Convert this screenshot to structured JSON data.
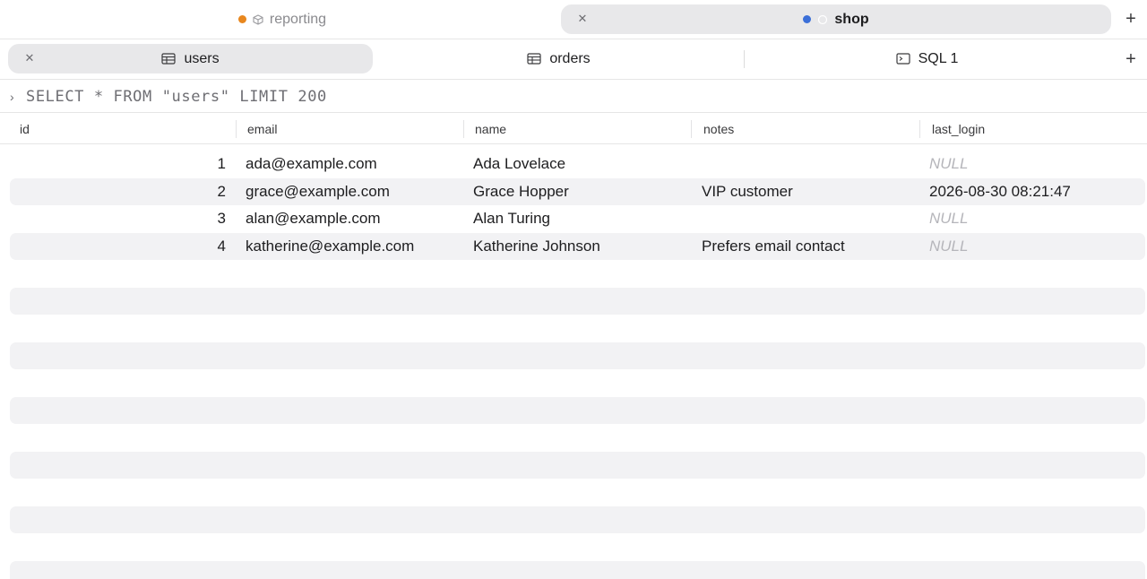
{
  "connections": [
    {
      "label": "reporting",
      "active": false,
      "dot_color": "#e8871e"
    },
    {
      "label": "shop",
      "active": true,
      "dot_color": "#3b6fd8"
    }
  ],
  "editor_tabs": [
    {
      "label": "users",
      "icon": "table-icon",
      "active": true
    },
    {
      "label": "orders",
      "icon": "table-icon",
      "active": false
    },
    {
      "label": "SQL 1",
      "icon": "terminal-icon",
      "active": false
    }
  ],
  "query": {
    "text": "SELECT * FROM \"users\" LIMIT 200"
  },
  "table": {
    "columns": [
      "id",
      "email",
      "name",
      "notes",
      "last_login"
    ],
    "rows": [
      {
        "id": "1",
        "email": "ada@example.com",
        "name": "Ada Lovelace",
        "notes": "",
        "last_login": "NULL"
      },
      {
        "id": "2",
        "email": "grace@example.com",
        "name": "Grace Hopper",
        "notes": "VIP customer",
        "last_login": "2026-08-30 08:21:47"
      },
      {
        "id": "3",
        "email": "alan@example.com",
        "name": "Alan Turing",
        "notes": "",
        "last_login": "NULL"
      },
      {
        "id": "4",
        "email": "katherine@example.com",
        "name": "Katherine Johnson",
        "notes": "Prefers email contact",
        "last_login": "NULL"
      }
    ]
  },
  "colors": {
    "accent": "#3b6fd8",
    "stripe": "#f2f2f4",
    "null_text": "#b5b5ba"
  }
}
